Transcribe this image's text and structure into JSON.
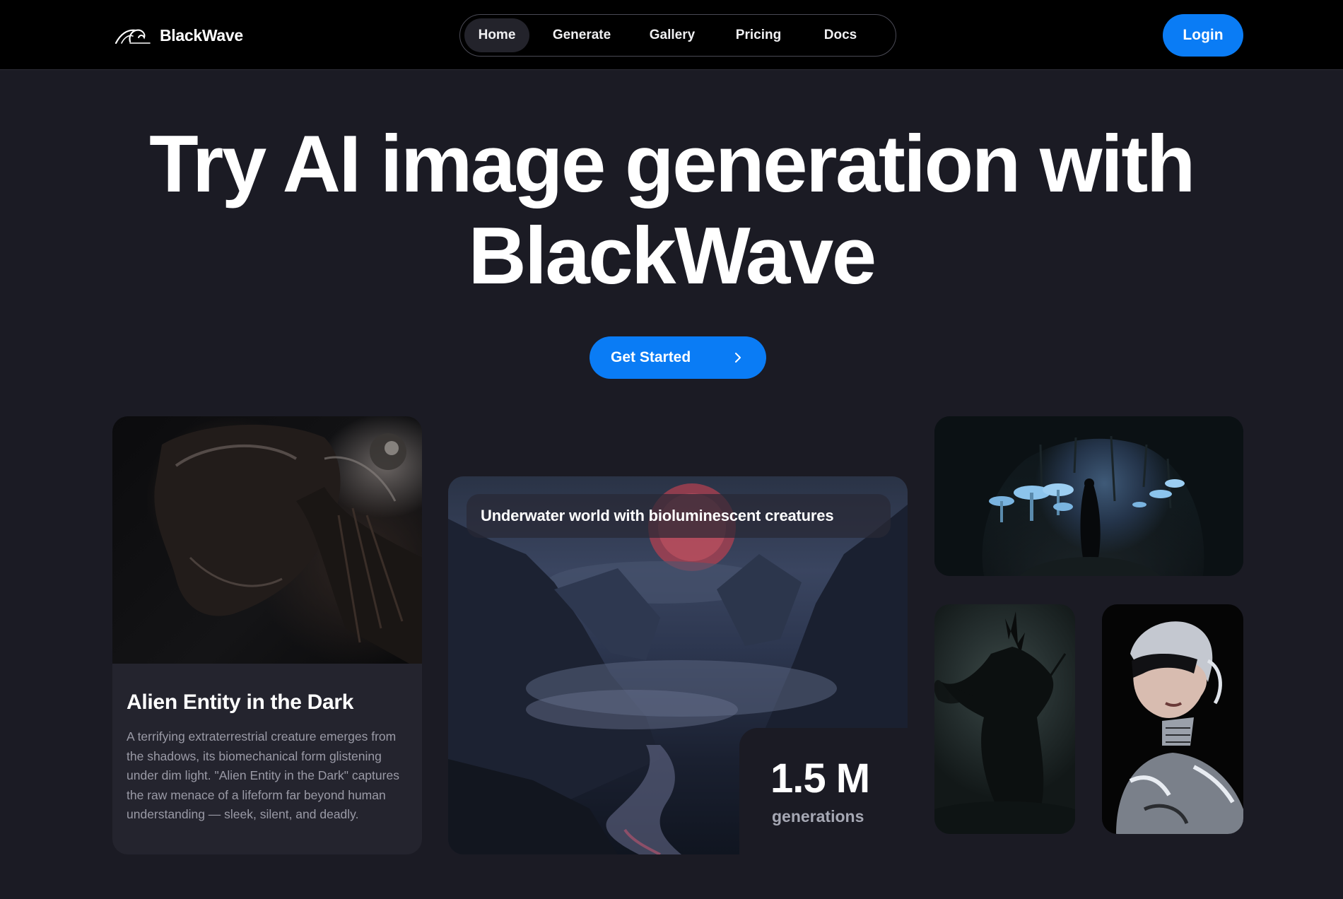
{
  "brand": {
    "name": "BlackWave",
    "logo_icon": "wave-icon"
  },
  "nav": {
    "items": [
      {
        "label": "Home",
        "active": true
      },
      {
        "label": "Generate",
        "active": false
      },
      {
        "label": "Gallery",
        "active": false
      },
      {
        "label": "Pricing",
        "active": false
      },
      {
        "label": "Docs",
        "active": false
      }
    ]
  },
  "header": {
    "login_label": "Login"
  },
  "hero": {
    "title_line1": "Try AI image generation with",
    "title_line2": "BlackWave",
    "cta_label": "Get Started",
    "cta_icon": "chevron-right-icon"
  },
  "cards": {
    "alien": {
      "title": "Alien Entity in the Dark",
      "description": "A terrifying extraterrestrial creature emerges from the shadows, its biomechanical form glistening under dim light. \"Alien Entity in the Dark\" captures the raw menace of a lifeform far beyond human understanding — sleek, silent, and deadly."
    },
    "landscape": {
      "prompt": "Underwater world with bioluminescent creatures"
    },
    "stats": {
      "value": "1.5 M",
      "label": "generations"
    }
  },
  "colors": {
    "accent": "#0a7cf5",
    "background": "#1b1b24",
    "header_bg": "#000000",
    "card_bg": "#24242e",
    "muted_text": "#9a9aa6"
  }
}
